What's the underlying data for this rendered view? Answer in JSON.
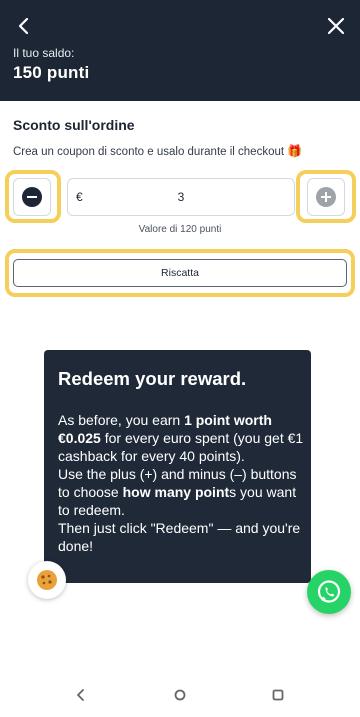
{
  "header": {
    "balance_label": "Il tuo saldo:",
    "balance_value": "150 punti"
  },
  "section": {
    "title": "Sconto sull'ordine",
    "description": "Crea un coupon di sconto e usalo durante il checkout",
    "description_emoji": "🎁"
  },
  "stepper": {
    "currency": "€",
    "quantity": "3",
    "minus_icon": "minus-icon",
    "plus_icon": "plus-icon"
  },
  "value_note": "Valore di 120 punti",
  "redeem_button": "Riscatta",
  "tooltip": {
    "title": "Redeem your reward.",
    "p1_a": "As before, you earn ",
    "p1_b": "1 point worth €0.025",
    "p1_c": " for every euro spent (you get €1 cashback for every 40 points).",
    "p2_a": "Use the plus (+) and minus (–) buttons to choose ",
    "p2_b": "how many point",
    "p2_c": "s you want to redeem.",
    "p3": "Then just click \"Redeem\" — and you're done!"
  },
  "colors": {
    "header_bg": "#1d2634",
    "highlight": "#f5cf5a",
    "tooltip_bg": "#1f2937",
    "whatsapp": "#25d366"
  }
}
